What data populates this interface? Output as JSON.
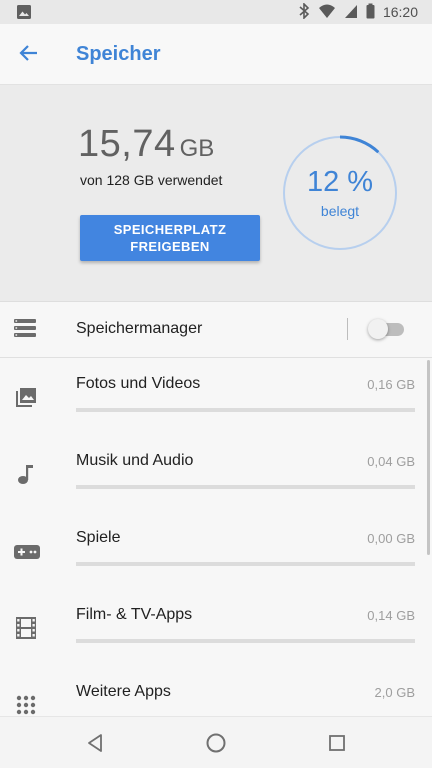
{
  "status_bar": {
    "time": "16:20",
    "icons": [
      "image-notification-icon",
      "bluetooth-icon",
      "wifi-icon",
      "signal-icon",
      "battery-icon"
    ]
  },
  "app_bar": {
    "title": "Speicher",
    "back_icon": "arrow-back-icon"
  },
  "summary": {
    "used_value": "15,74",
    "used_unit": "GB",
    "used_of": "von 128 GB verwendet",
    "free_button_line1": "SPEICHERPLATZ",
    "free_button_line2": "FREIGEBEN",
    "percent_text": "12 %",
    "percent_label": "belegt",
    "percent_value": 12
  },
  "storage_manager": {
    "label": "Speichermanager",
    "enabled": false
  },
  "categories": [
    {
      "label": "Fotos und Videos",
      "size": "0,16 GB",
      "icon": "photo-icon",
      "fraction": 0.0
    },
    {
      "label": "Musik und Audio",
      "size": "0,04 GB",
      "icon": "music-note-icon",
      "fraction": 0.0
    },
    {
      "label": "Spiele",
      "size": "0,00 GB",
      "icon": "gamepad-icon",
      "fraction": 0.0
    },
    {
      "label": "Film- & TV-Apps",
      "size": "0,14 GB",
      "icon": "film-icon",
      "fraction": 0.0
    },
    {
      "label": "Weitere Apps",
      "size": "2,0 GB",
      "icon": "apps-grid-icon",
      "fraction": 0.0
    }
  ],
  "colors": {
    "accent": "#3f84d6",
    "button": "#4285e0"
  },
  "nav_bar": {
    "icons": [
      "nav-back-icon",
      "nav-home-icon",
      "nav-recents-icon"
    ]
  }
}
